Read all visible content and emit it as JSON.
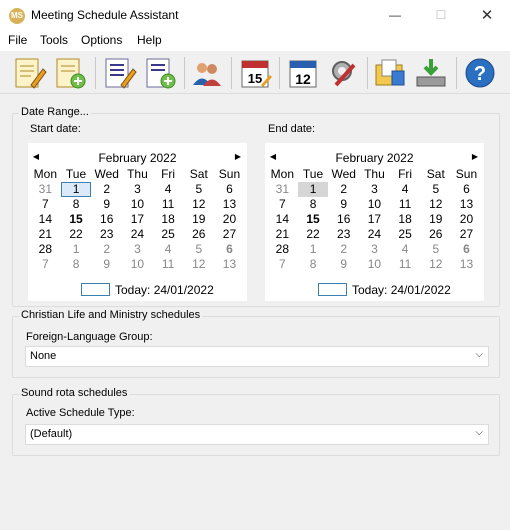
{
  "window": {
    "title": "Meeting Schedule Assistant",
    "icon_text": "MS",
    "minimize_glyph": "—",
    "maximize_glyph": "☐",
    "close_glyph": "✕"
  },
  "menu": [
    "File",
    "Tools",
    "Options",
    "Help"
  ],
  "toolbar": {
    "buttons": [
      "edit-notes-icon",
      "add-notes-icon",
      "edit-report-icon",
      "add-report-icon",
      "people-icon",
      "calendar-15-icon",
      "calendar-12-icon",
      "tools-settings-icon",
      "folder-documents-icon",
      "download-drive-icon",
      "help-icon"
    ]
  },
  "date_range": {
    "group_title": "Date Range...",
    "start_label": "Start date:",
    "end_label": "End date:",
    "weekdays": [
      "Mon",
      "Tue",
      "Wed",
      "Thu",
      "Fri",
      "Sat",
      "Sun"
    ],
    "start": {
      "month": "February 2022",
      "rows": [
        [
          "31",
          "1",
          "2",
          "3",
          "4",
          "5",
          "6"
        ],
        [
          "7",
          "8",
          "9",
          "10",
          "11",
          "12",
          "13"
        ],
        [
          "14",
          "15",
          "16",
          "17",
          "18",
          "19",
          "20"
        ],
        [
          "21",
          "22",
          "23",
          "24",
          "25",
          "26",
          "27"
        ],
        [
          "28",
          "1",
          "2",
          "3",
          "4",
          "5",
          "6"
        ],
        [
          "7",
          "8",
          "9",
          "10",
          "11",
          "12",
          "13"
        ]
      ],
      "today": "Today: 24/01/2022"
    },
    "end": {
      "month": "February 2022",
      "rows": [
        [
          "31",
          "1",
          "2",
          "3",
          "4",
          "5",
          "6"
        ],
        [
          "7",
          "8",
          "9",
          "10",
          "11",
          "12",
          "13"
        ],
        [
          "14",
          "15",
          "16",
          "17",
          "18",
          "19",
          "20"
        ],
        [
          "21",
          "22",
          "23",
          "24",
          "25",
          "26",
          "27"
        ],
        [
          "28",
          "1",
          "2",
          "3",
          "4",
          "5",
          "6"
        ],
        [
          "7",
          "8",
          "9",
          "10",
          "11",
          "12",
          "13"
        ]
      ],
      "today": "Today: 24/01/2022"
    },
    "prev_glyph": "◀",
    "next_glyph": "▶"
  },
  "clm": {
    "group_title": "Christian Life and Ministry schedules",
    "label": "Foreign-Language Group:",
    "value": "None"
  },
  "sound": {
    "group_title": "Sound rota schedules",
    "label": "Active Schedule Type:",
    "value": "(Default)"
  },
  "dropdown_glyph": "⌵"
}
